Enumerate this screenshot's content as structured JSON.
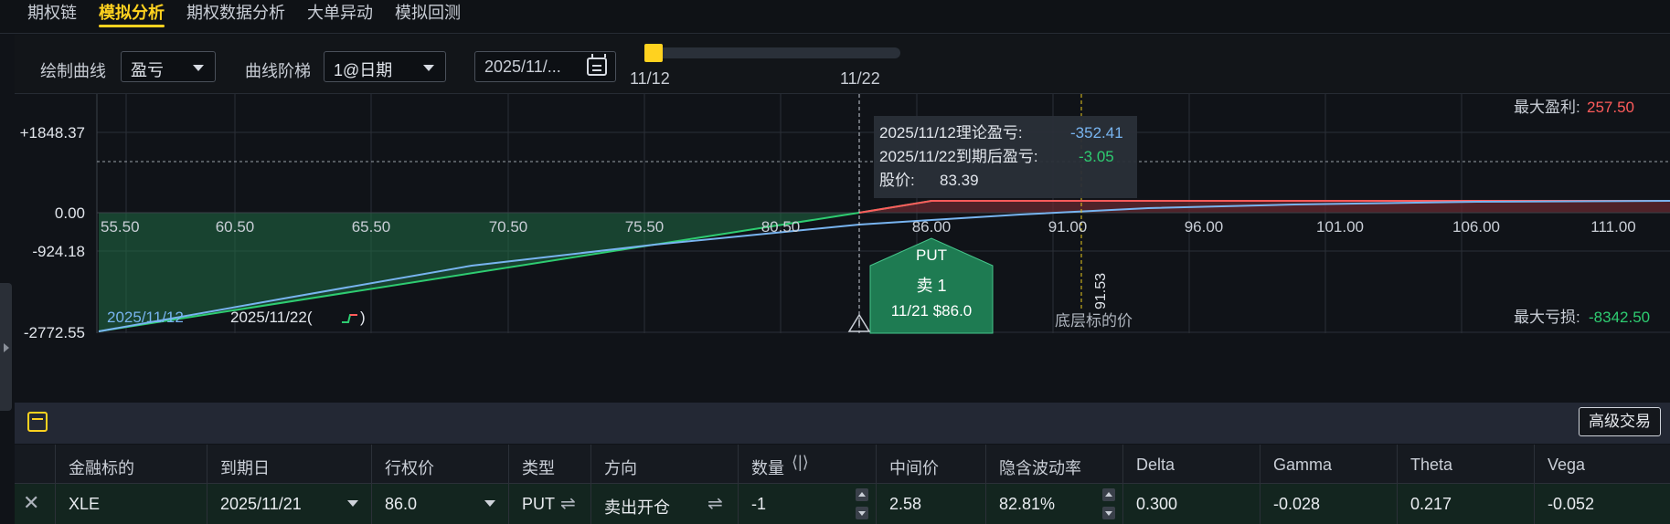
{
  "tabs": [
    {
      "label": "期权链"
    },
    {
      "label": "模拟分析"
    },
    {
      "label": "期权数据分析"
    },
    {
      "label": "大单异动"
    },
    {
      "label": "模拟回测"
    }
  ],
  "controls": {
    "draw_curve_label": "绘制曲线",
    "draw_curve_value": "盈亏",
    "curve_step_label": "曲线阶梯",
    "curve_step_value": "1@日期",
    "date_value": "2025/11/...",
    "slider_start": "11/12",
    "slider_end": "11/22",
    "slider_position": 0
  },
  "chart": {
    "y_ticks": [
      "+1848.37",
      "0.00",
      "-924.18",
      "-2772.55"
    ],
    "x_ticks": [
      "55.50",
      "60.50",
      "65.50",
      "70.50",
      "75.50",
      "80.50",
      "86.00",
      "91.00",
      "96.00",
      "101.00",
      "106.00",
      "111.00"
    ],
    "max_profit_label": "最大盈利:",
    "max_profit_value": "257.50",
    "max_loss_label": "最大亏损:",
    "max_loss_value": "-8342.50",
    "tooltip": {
      "row1_label": "2025/11/12理论盈亏:",
      "row1_value": "-352.41",
      "row2_label": "2025/11/22到期后盈亏:",
      "row2_value": "-3.05",
      "row3_label": "股价:",
      "row3_value": "83.39"
    },
    "put_marker": {
      "type": "PUT",
      "action": "卖 1",
      "detail": "11/21 $86.0"
    },
    "underlying_price_value": "91.53",
    "underlying_price_label": "底层标的价",
    "legend_theoretical": "2025/11/12",
    "legend_expiry": "2025/11/22(",
    "legend_expiry_close": ")",
    "colors": {
      "expiry_line": "#ff5b5b",
      "theo_line": "#78b4f0",
      "loss_fill": "#1f6b46",
      "profit_fill": "#6b2a30",
      "underlying": "#e8c81e"
    }
  },
  "panel": {
    "advanced_trade": "高级交易"
  },
  "table": {
    "headers": [
      "金融标的",
      "到期日",
      "行权价",
      "类型",
      "方向",
      "数量",
      "中间价",
      "隐含波动率",
      "Delta",
      "Gamma",
      "Theta",
      "Vega"
    ],
    "row": {
      "symbol": "XLE",
      "expiry": "2025/11/21",
      "strike": "86.0",
      "type": "PUT",
      "direction": "卖出开仓",
      "qty": "-1",
      "mid": "2.58",
      "iv": "82.81%",
      "delta": "0.300",
      "gamma": "-0.028",
      "theta": "0.217",
      "vega": "-0.052"
    }
  }
}
